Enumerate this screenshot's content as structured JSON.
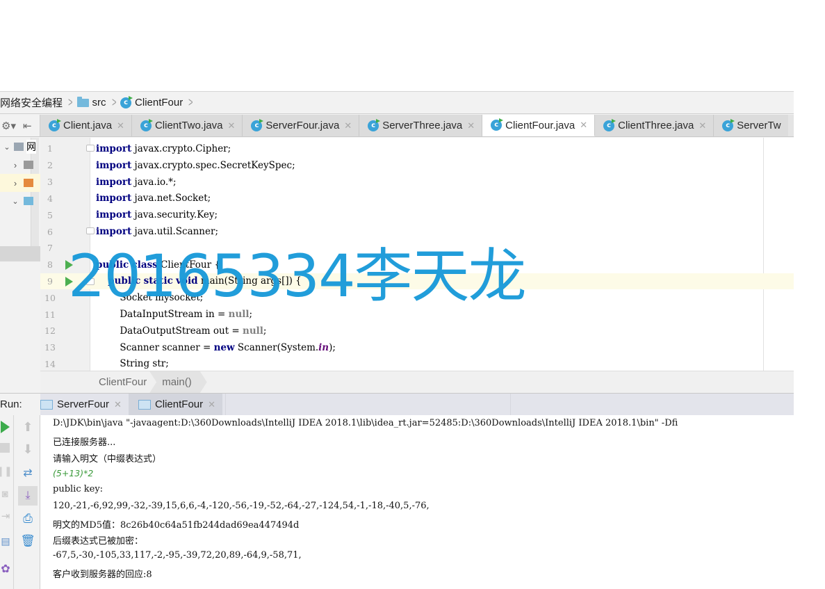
{
  "breadcrumb": {
    "project": "网络安全编程",
    "folder": "src",
    "file": "ClientFour"
  },
  "tabs": [
    {
      "label": "Client.java",
      "active": false
    },
    {
      "label": "ClientTwo.java",
      "active": false
    },
    {
      "label": "ServerFour.java",
      "active": false
    },
    {
      "label": "ServerThree.java",
      "active": false
    },
    {
      "label": "ClientFour.java",
      "active": true
    },
    {
      "label": "ClientThree.java",
      "active": false
    },
    {
      "label": "ServerTw",
      "active": false
    }
  ],
  "project_tree": {
    "root_label": "网"
  },
  "editor": {
    "lines": [
      {
        "n": "1",
        "kw": "import",
        "rest": " javax.crypto.Cipher;"
      },
      {
        "n": "2",
        "kw": "import",
        "rest": " javax.crypto.spec.SecretKeySpec;"
      },
      {
        "n": "3",
        "kw": "import",
        "rest": " java.io.*;"
      },
      {
        "n": "4",
        "kw": "import",
        "rest": " java.net.Socket;"
      },
      {
        "n": "5",
        "kw": "import",
        "rest": " java.security.Key;"
      },
      {
        "n": "6",
        "kw": "import",
        "rest": " java.util.Scanner;"
      },
      {
        "n": "7"
      },
      {
        "n": "8",
        "text": "public class ClientFour {"
      },
      {
        "n": "9",
        "text": "    public static void main(String args[]) {"
      },
      {
        "n": "10",
        "text": "        Socket mysocket;"
      },
      {
        "n": "11",
        "text": "        DataInputStream in = null;"
      },
      {
        "n": "12",
        "text": "        DataOutputStream out = null;"
      },
      {
        "n": "13",
        "text": "        Scanner scanner = new Scanner(System.in);"
      },
      {
        "n": "14",
        "text": "        String str;"
      }
    ],
    "tokens": {
      "l8_kw1": "public",
      "l8_kw2": "class",
      "l8_rest": " ClientFour {",
      "l9_indent": "    ",
      "l9_kw1": "public",
      "l9_kw2": "static",
      "l9_kw3": "void",
      "l9_rest": " main(String args[]) {",
      "l10": "        Socket mysocket;",
      "l11_a": "        DataInputStream in = ",
      "l11_null": "null",
      "l11_b": ";",
      "l12_a": "        DataOutputStream out = ",
      "l12_null": "null",
      "l12_b": ";",
      "l13_a": "        Scanner scanner = ",
      "l13_new": "new",
      "l13_b": " Scanner(System.",
      "l13_in": "in",
      "l13_c": ");",
      "l14": "        String str;"
    }
  },
  "watermark": "20165334李天龙",
  "editor_breadcrumb": [
    "ClientFour",
    "main()"
  ],
  "run_panel": {
    "label": "Run:",
    "tabs": [
      {
        "label": "ServerFour",
        "active": false
      },
      {
        "label": "ClientFour",
        "active": true
      }
    ]
  },
  "console": {
    "lines": [
      {
        "text": "D:\\JDK\\bin\\java \"-javaagent:D:\\360Downloads\\IntelliJ IDEA 2018.1\\lib\\idea_rt.jar=52485:D:\\360Downloads\\IntelliJ IDEA 2018.1\\bin\" -Dfi",
        "type": "cmd"
      },
      {
        "text": "已连接服务器...",
        "type": "out"
      },
      {
        "text": "请输入明文（中缀表达式）",
        "type": "out"
      },
      {
        "text": "(5+13)*2",
        "type": "input"
      },
      {
        "text": "public key:",
        "type": "out"
      },
      {
        "text": "120,-21,-6,92,99,-32,-39,15,6,6,-4,-120,-56,-19,-52,-64,-27,-124,54,-1,-18,-40,5,-76,",
        "type": "out"
      },
      {
        "text": "明文的MD5值：8c26b40c64a51fb244dad69ea447494d",
        "type": "out"
      },
      {
        "text": "后缀表达式已被加密：",
        "type": "out"
      },
      {
        "text": "-67,5,-30,-105,33,117,-2,-95,-39,72,20,89,-64,9,-58,71,",
        "type": "out"
      },
      {
        "text": "客户收到服务器的回应:8",
        "type": "out"
      }
    ]
  },
  "colors": {
    "watermark": "#1a9ad9",
    "keyword": "#000080",
    "user_input": "#3a9a3a",
    "run_green": "#4caf50",
    "current_line": "#fdfbe7"
  }
}
